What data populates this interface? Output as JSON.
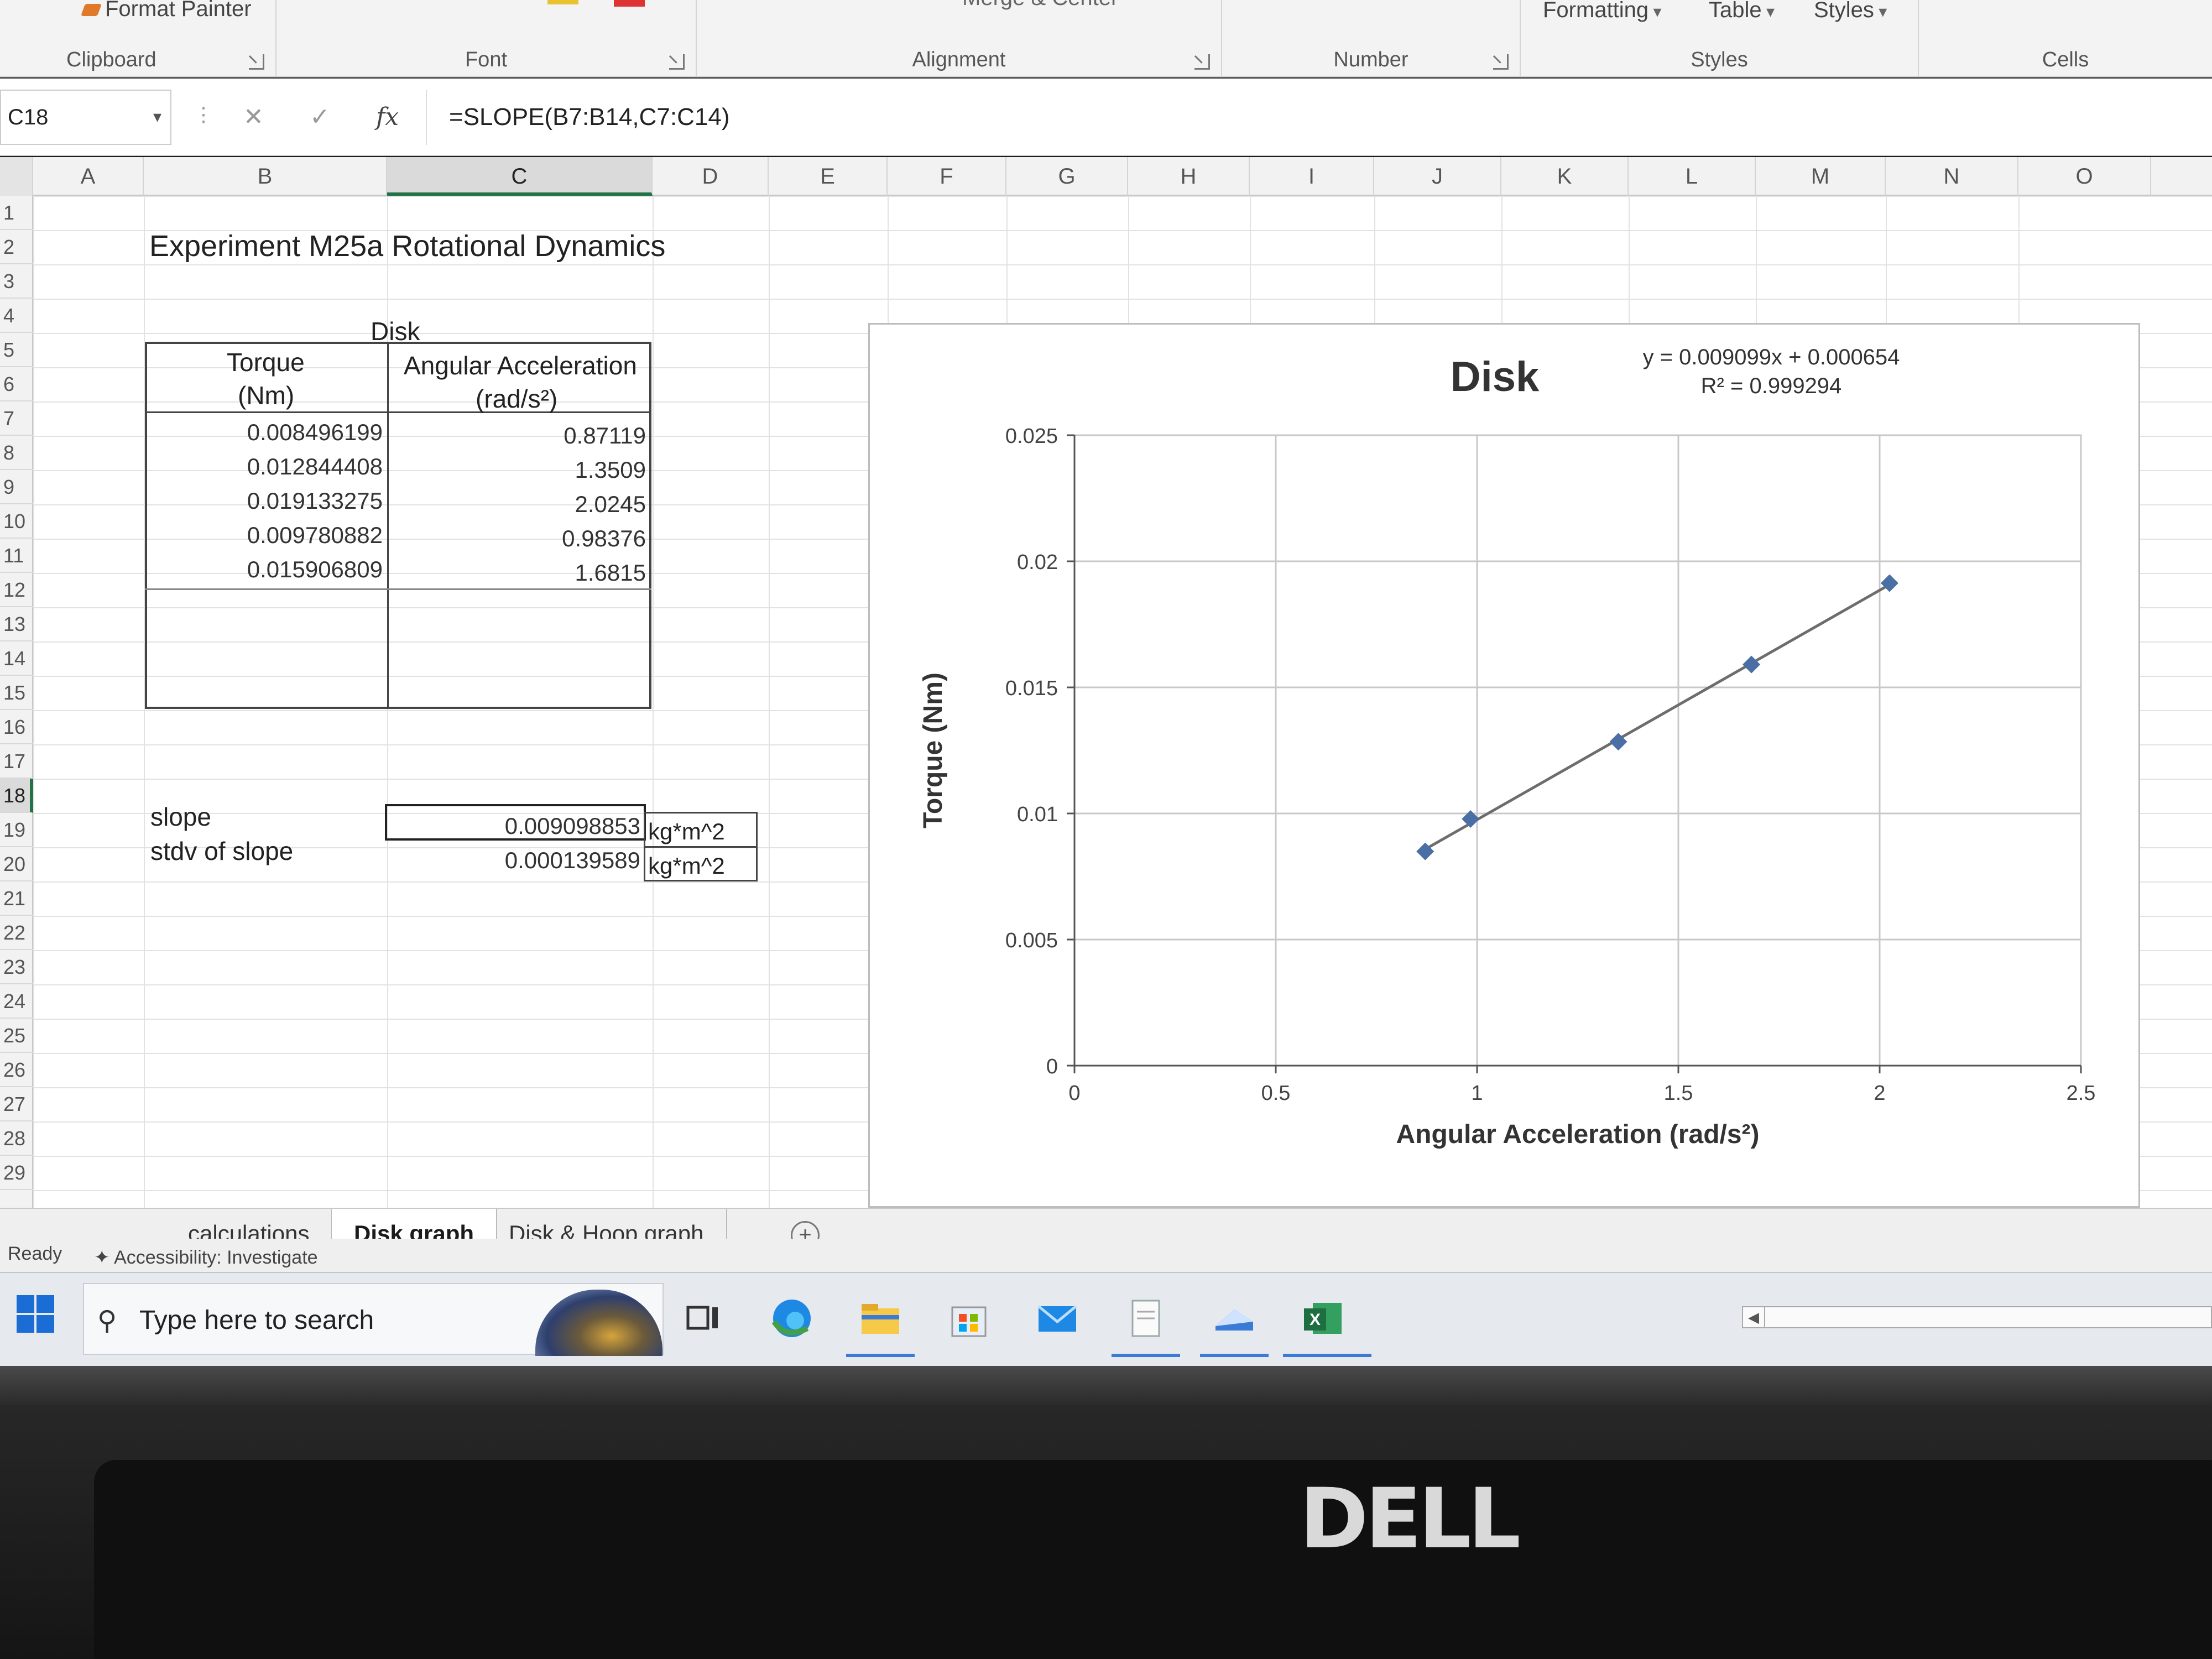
{
  "ribbon": {
    "clipboard": {
      "format_painter": "Format Painter",
      "label": "Clipboard"
    },
    "font": {
      "label": "Font"
    },
    "alignment": {
      "label": "Alignment",
      "merge_center": "Merge & Center"
    },
    "number": {
      "label": "Number"
    },
    "styles": {
      "formatting": "Formatting",
      "table": "Table",
      "styles": "Styles",
      "label": "Styles"
    },
    "cells": {
      "label": "Cells"
    }
  },
  "formula_bar": {
    "name_box": "C18",
    "formula": "=SLOPE(B7:B14,C7:C14)"
  },
  "columns": [
    "A",
    "B",
    "C",
    "D",
    "E",
    "F",
    "G",
    "H",
    "I",
    "J",
    "K",
    "L",
    "M",
    "N",
    "O"
  ],
  "rows": [
    "1",
    "2",
    "3",
    "4",
    "5",
    "6",
    "7",
    "8",
    "9",
    "10",
    "11",
    "12",
    "13",
    "14",
    "15",
    "16",
    "17",
    "18",
    "19",
    "20",
    "21",
    "22",
    "23",
    "24",
    "25",
    "26",
    "27",
    "28",
    "29"
  ],
  "sheet": {
    "title": "Experiment M25a  Rotational Dynamics",
    "table_caption": "Disk",
    "headers": {
      "torque": "Torque",
      "torque_unit": "(Nm)",
      "accel": "Angular Acceleration",
      "accel_unit": "(rad/s²)"
    },
    "torque": [
      "0.008496199",
      "0.012844408",
      "0.019133275",
      "0.009780882",
      "0.015906809"
    ],
    "accel": [
      "0.87119",
      "1.3509",
      "2.0245",
      "0.98376",
      "1.6815"
    ],
    "slope_label": "slope",
    "stdv_label": "stdv of slope",
    "slope_value": "0.009098853",
    "stdv_value": "0.000139589",
    "unit": "kg*m^2"
  },
  "chart_data": {
    "type": "scatter",
    "title": "Disk",
    "xlabel": "Angular Acceleration (rad/s²)",
    "ylabel": "Torque (Nm)",
    "xlim": [
      0,
      2.5
    ],
    "ylim": [
      0,
      0.025
    ],
    "x_ticks": [
      "0",
      "0.5",
      "1",
      "1.5",
      "2",
      "2.5"
    ],
    "y_ticks": [
      "0",
      "0.005",
      "0.01",
      "0.015",
      "0.02",
      "0.025"
    ],
    "grid": true,
    "trendline": {
      "slope": 0.009099,
      "intercept": 0.000654,
      "equation": "y = 0.009099x + 0.000654",
      "r2": "R² = 0.999294"
    },
    "series": [
      {
        "x": [
          0.87119,
          1.3509,
          2.0245,
          0.98376,
          1.6815
        ],
        "y": [
          0.008496199,
          0.012844408,
          0.019133275,
          0.009780882,
          0.015906809
        ]
      }
    ],
    "colors": {
      "marker": "#4a6fa5",
      "line": "#6d6d6d"
    }
  },
  "tabs": [
    "calculations",
    "Disk graph",
    "Disk & Hoop graph"
  ],
  "status": {
    "ready": "Ready",
    "accessibility": "Accessibility: Investigate"
  },
  "taskbar": {
    "search_placeholder": "Type here to search"
  },
  "bezel": {
    "brand": "DELL"
  }
}
